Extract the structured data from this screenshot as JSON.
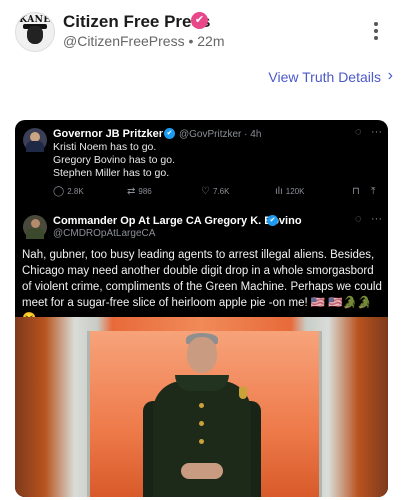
{
  "post": {
    "author_name": "Citizen Free Press",
    "avatar_text": "KANE",
    "handle": "@CitizenFreePress",
    "separator": "•",
    "time": "22m",
    "view_details": "View Truth Details"
  },
  "embed": {
    "tweet1": {
      "name": "Governor JB Pritzker",
      "handle": "@GovPritzker",
      "separator": "·",
      "time": "4h",
      "lines": [
        "Kristi Noem has to go.",
        "Gregory Bovino has to go.",
        "Stephen Miller has to go."
      ],
      "replies": "2.8K",
      "retweets": "986",
      "likes": "7.6K",
      "views": "120K"
    },
    "tweet2": {
      "name": "Commander Op At Large CA Gregory K. Bovino",
      "handle": "@CMDROpAtLargeCA",
      "body": "Nah, gubner, too busy leading agents to arrest illegal aliens.  Besides, Chicago may need another double digit drop in a whole smorgasbord of violent crime, compliments of the Green Machine.  Perhaps we could meet for a sugar-free slice of heirloom apple pie -on me! 🇺🇸 🇺🇸🐊🐊😆"
    }
  },
  "icons": {
    "verified_badge": "✔",
    "more": "more-vertical-icon",
    "chevron": "›",
    "reply": "💬",
    "retweet": "⇄",
    "like": "♡",
    "views": "📊",
    "bookmark": "🔖",
    "share": "⤴",
    "grok": "◌",
    "ellipsis": "···"
  },
  "colors": {
    "brand_badge": "#e8488a",
    "link": "#4b59c9",
    "twitter_blue": "#1d9bf0",
    "card_bg": "#000000"
  }
}
